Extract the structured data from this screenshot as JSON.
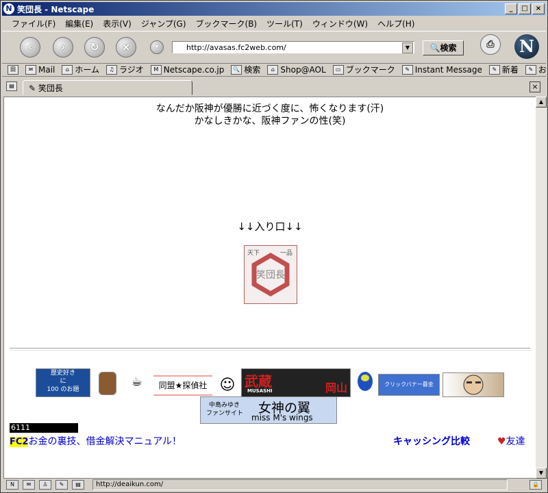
{
  "window": {
    "title": "笑団長 - Netscape"
  },
  "menu": [
    "ファイル(F)",
    "編集(E)",
    "表示(V)",
    "ジャンプ(G)",
    "ブックマーク(B)",
    "ツール(T)",
    "ウィンドウ(W)",
    "ヘルプ(H)"
  ],
  "navbar": {
    "url": "http://avasas.fc2web.com/",
    "search_label": "検索"
  },
  "personal": [
    "Mail",
    "ホーム",
    "ラジオ",
    "Netscape.co.jp",
    "検索",
    "Shop@AOL",
    "ブックマーク",
    "Instant Message",
    "新着",
    "お勧め"
  ],
  "tab": {
    "label": "笑団長"
  },
  "page": {
    "line1": "なんだか阪神が優勝に近づく度に、怖くなります(汗)",
    "line2": "かなしきかな、阪神ファンの性(笑)",
    "entrance": "↓↓入り口↓↓",
    "stamp_top_left": "天下",
    "stamp_top_right": "一品",
    "stamp_center": "笑団長",
    "banners": {
      "b1_line1": "歴史好き",
      "b1_line2": "に",
      "b1_line3": "100 のお題",
      "b2": "同盟★探偵社",
      "b3_left": "武蔵",
      "b3_sub": "MUSASHI",
      "b3_right": "岡山",
      "b4": "クリックバナー募金",
      "b5_line1": "中島みゆき",
      "b5_line2": "ファンサイト",
      "b5_title": "女神の翼",
      "b5_sub": "miss M's wings"
    },
    "counter": "6111",
    "fc2_tag": "FC2",
    "fc2_text": "お金の裏技、借金解決マニュアル！",
    "cashing": "キャッシング比較",
    "friends": "友達"
  },
  "status": {
    "url": "http://deaikun.com/"
  }
}
